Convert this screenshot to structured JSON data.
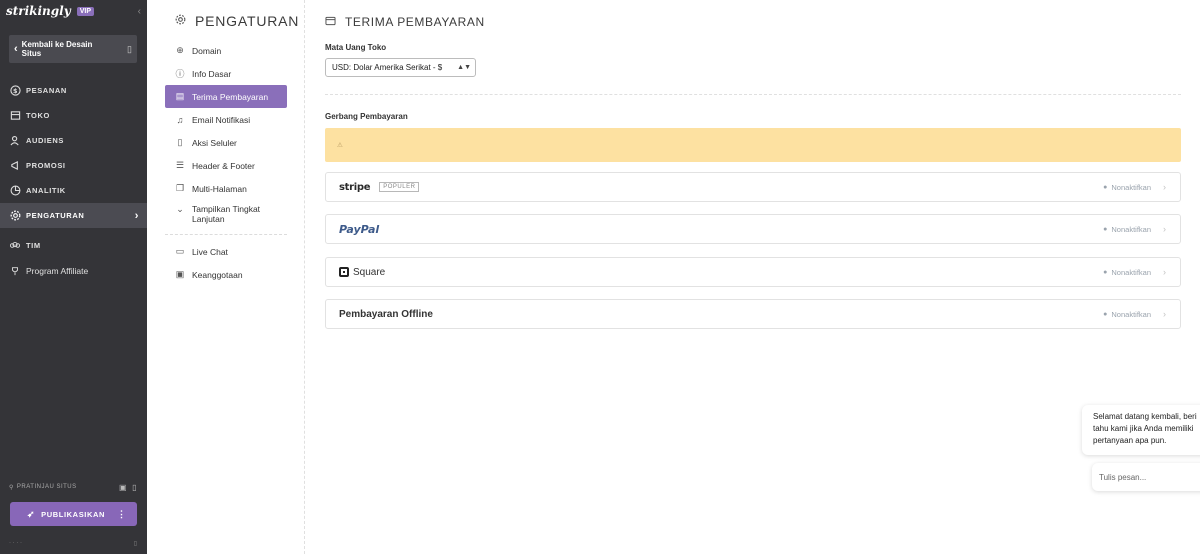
{
  "brand": {
    "logo": "strikingly",
    "badge": "VIP"
  },
  "sidebar": {
    "back_label": "Kembali ke Desain Situs",
    "items": [
      {
        "label": "PESANAN",
        "icon": "dollar-circle-icon"
      },
      {
        "label": "TOKO",
        "icon": "store-icon"
      },
      {
        "label": "AUDIENS",
        "icon": "users-icon"
      },
      {
        "label": "PROMOSI",
        "icon": "megaphone-icon"
      },
      {
        "label": "ANALITIK",
        "icon": "pie-chart-icon"
      },
      {
        "label": "PENGATURAN",
        "icon": "gear-icon"
      },
      {
        "label": "TIM",
        "icon": "team-icon"
      },
      {
        "label": "Program Affiliate",
        "icon": "trophy-icon"
      }
    ],
    "preview_label": "PRATINJAU SITUS",
    "publish_label": "PUBLIKASIKAN"
  },
  "submenu": {
    "title": "PENGATURAN",
    "items": [
      {
        "label": "Domain",
        "icon": "globe-icon"
      },
      {
        "label": "Info Dasar",
        "icon": "info-icon"
      },
      {
        "label": "Terima Pembayaran",
        "icon": "credit-card-icon"
      },
      {
        "label": "Email Notifikasi",
        "icon": "bell-icon"
      },
      {
        "label": "Aksi Seluler",
        "icon": "mobile-icon"
      },
      {
        "label": "Header & Footer",
        "icon": "layout-icon"
      },
      {
        "label": "Multi-Halaman",
        "icon": "pages-icon"
      },
      {
        "label": "Tampilkan Tingkat Lanjutan",
        "icon": "chevron-down-icon"
      },
      {
        "label": "Live Chat",
        "icon": "chat-icon"
      },
      {
        "label": "Keanggotaan",
        "icon": "member-icon"
      }
    ]
  },
  "main": {
    "title": "TERIMA PEMBAYARAN",
    "currency_label": "Mata Uang Toko",
    "currency_value": "USD: Dolar Amerika Serikat - $",
    "gateway_label": "Gerbang Pembayaran",
    "gateways": [
      {
        "name": "stripe",
        "badge": "POPULER",
        "action": "Nonaktifkan"
      },
      {
        "name": "PayPal",
        "action": "Nonaktifkan"
      },
      {
        "name": "Square",
        "action": "Nonaktifkan"
      },
      {
        "name": "Pembayaran Offline",
        "action": "Nonaktifkan"
      }
    ]
  },
  "chat": {
    "message": "Selamat datang kembali, beri tahu kami jika Anda memiliki pertanyaan apa pun.",
    "input_placeholder": "Tulis pesan..."
  },
  "colors": {
    "sidebar_bg": "#343438",
    "accent": "#8a6fba",
    "notice_bg": "#fde1a1"
  }
}
